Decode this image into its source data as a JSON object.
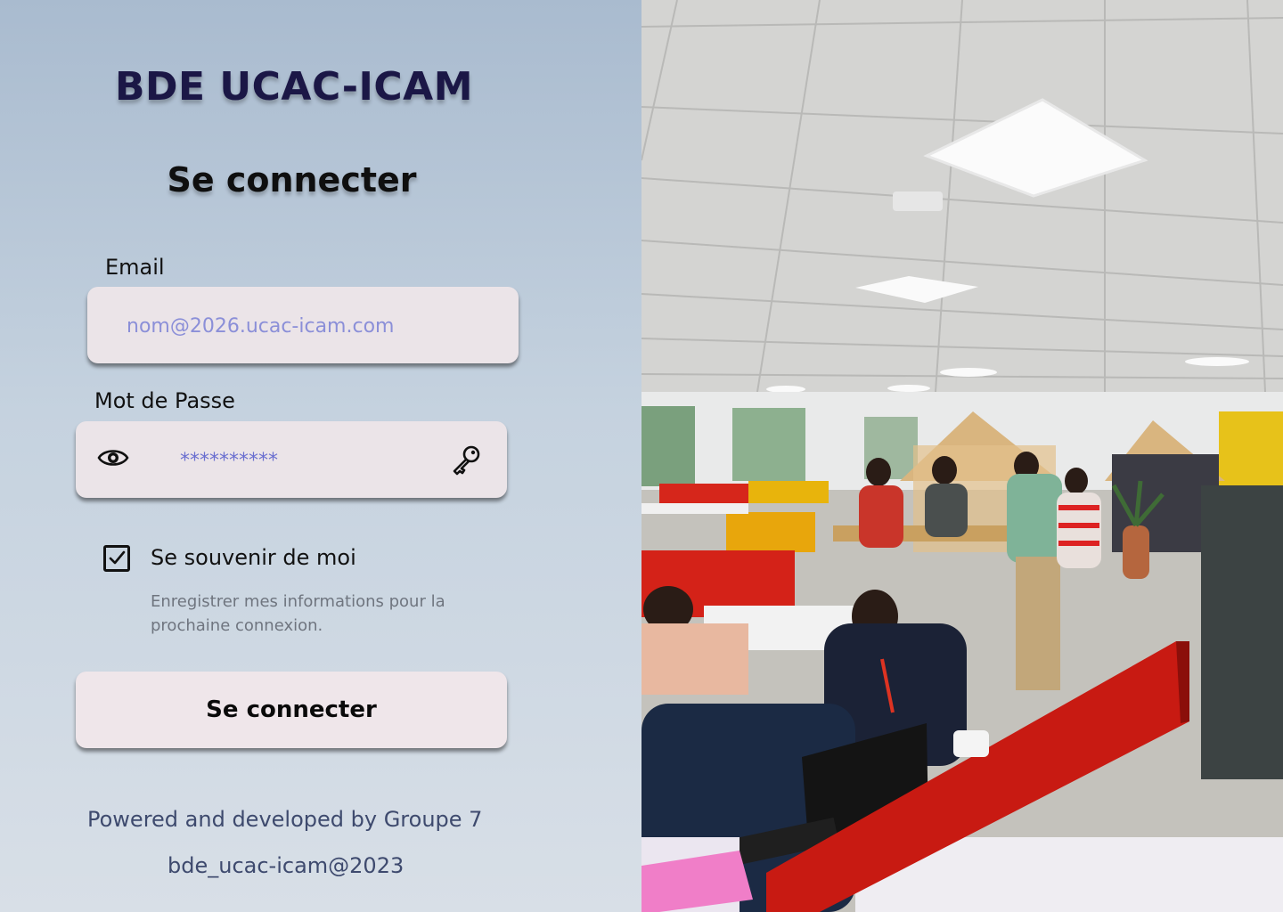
{
  "brand": {
    "title": "BDE UCAC-ICAM"
  },
  "form": {
    "heading": "Se connecter",
    "email_label": "Email",
    "email_placeholder": "nom@2026.ucac-icam.com",
    "password_label": "Mot de Passe",
    "password_placeholder": "**********",
    "remember_label": "Se souvenir de moi",
    "remember_checked": true,
    "remember_hint": "Enregistrer mes informations pour la prochaine connexion.",
    "submit_label": "Se connecter"
  },
  "icons": {
    "password_visibility": "eye-icon",
    "password_key": "key-icon",
    "remember_check": "checkmark-icon"
  },
  "footer": {
    "credit": "Powered and developed by  Groupe 7",
    "copyright": "bde_ucac-icam@2023"
  },
  "colors": {
    "brand_text": "#1b1746",
    "placeholder": "#8b8fd8",
    "field_bg": "#ebe4e8",
    "footer_text": "#3e4a6e"
  }
}
